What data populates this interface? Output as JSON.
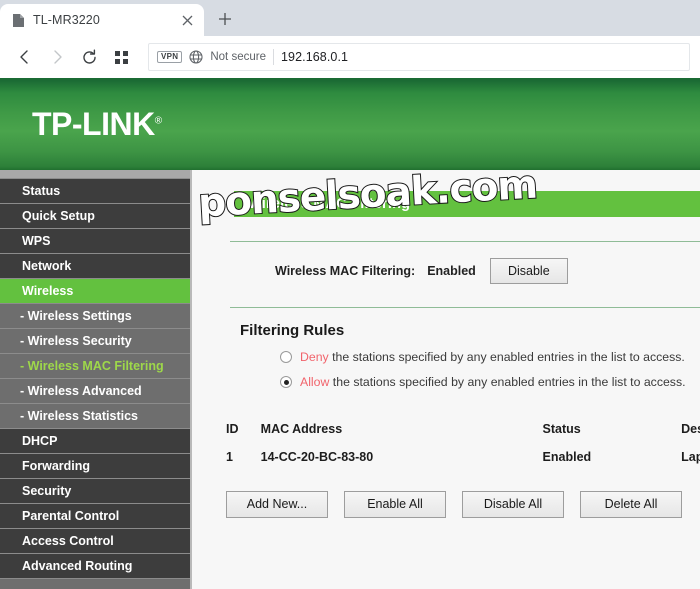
{
  "browser": {
    "tab": {
      "title": "TL-MR3220",
      "favicon_icon": "page-icon",
      "close_icon": "×"
    },
    "new_tab_icon": "+",
    "nav": {
      "back_icon": "chevron-left",
      "forward_icon": "chevron-right",
      "reload_icon": "reload",
      "apps_icon": "grid"
    },
    "omnibox": {
      "vpn_badge": "VPN",
      "security_icon": "globe-icon",
      "security_text": "Not secure",
      "url": "192.168.0.1"
    }
  },
  "brand": {
    "name": "TP-LINK",
    "trademark": "®"
  },
  "watermark": "ponselsoak.com",
  "sidebar": {
    "items": [
      {
        "label": "Status",
        "type": "top",
        "state": "normal"
      },
      {
        "label": "Quick Setup",
        "type": "top",
        "state": "normal"
      },
      {
        "label": "WPS",
        "type": "top",
        "state": "normal"
      },
      {
        "label": "Network",
        "type": "top",
        "state": "normal"
      },
      {
        "label": "Wireless",
        "type": "top",
        "state": "active"
      },
      {
        "label": "- Wireless Settings",
        "type": "sub",
        "state": "normal"
      },
      {
        "label": "- Wireless Security",
        "type": "sub",
        "state": "normal"
      },
      {
        "label": "- Wireless MAC Filtering",
        "type": "sub",
        "state": "active-sub"
      },
      {
        "label": "- Wireless Advanced",
        "type": "sub",
        "state": "normal"
      },
      {
        "label": "- Wireless Statistics",
        "type": "sub",
        "state": "normal"
      },
      {
        "label": "DHCP",
        "type": "top",
        "state": "normal"
      },
      {
        "label": "Forwarding",
        "type": "top",
        "state": "normal"
      },
      {
        "label": "Security",
        "type": "top",
        "state": "normal"
      },
      {
        "label": "Parental Control",
        "type": "top",
        "state": "normal"
      },
      {
        "label": "Access Control",
        "type": "top",
        "state": "normal"
      },
      {
        "label": "Advanced Routing",
        "type": "top",
        "state": "normal"
      }
    ]
  },
  "main": {
    "section_title": "Wireless MAC Filtering",
    "status": {
      "label": "Wireless MAC Filtering:",
      "value": "Enabled",
      "toggle_button": "Disable"
    },
    "filtering_rules": {
      "heading": "Filtering Rules",
      "options": [
        {
          "keyword": "Deny",
          "text": " the stations specified by any enabled entries in the list to access.",
          "selected": false
        },
        {
          "keyword": "Allow",
          "text": " the stations specified by any enabled entries in the list to access.",
          "selected": true
        }
      ]
    },
    "table": {
      "headers": [
        "ID",
        "MAC Address",
        "Status",
        "Description"
      ],
      "rows": [
        {
          "id": "1",
          "mac": "14-CC-20-BC-83-80",
          "status": "Enabled",
          "description": "Laptop Asus"
        }
      ]
    },
    "buttons": [
      "Add New...",
      "Enable All",
      "Disable All",
      "Delete All"
    ]
  },
  "colors": {
    "brand_green": "#63c13f",
    "header_green": "#3f9a46",
    "accent_red": "#f1646c",
    "sidebar_dark": "#3d3d3d",
    "sidebar_sub": "#6e6e6e",
    "sub_active_text": "#9ed84a"
  }
}
